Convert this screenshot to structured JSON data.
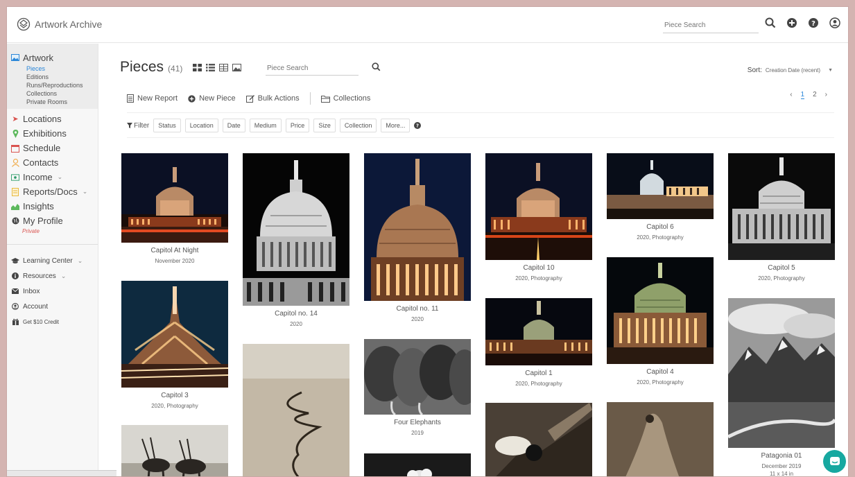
{
  "app": {
    "name": "Artwork Archive"
  },
  "topbar": {
    "search_placeholder": "Piece Search"
  },
  "sidebar": {
    "artwork_label": "Artwork",
    "artwork_subs": [
      {
        "label": "Pieces",
        "active": true
      },
      {
        "label": "Editions"
      },
      {
        "label": "Runs/Reproductions"
      },
      {
        "label": "Collections"
      },
      {
        "label": "Private Rooms"
      }
    ],
    "main_items": [
      {
        "label": "Locations",
        "icon": "location-arrow-icon",
        "color": "#d9534f"
      },
      {
        "label": "Exhibitions",
        "icon": "map-pin-icon",
        "color": "#5cb85c"
      },
      {
        "label": "Schedule",
        "icon": "calendar-icon",
        "color": "#d9534f"
      },
      {
        "label": "Contacts",
        "icon": "user-icon",
        "color": "#f0ad4e"
      },
      {
        "label": "Income",
        "icon": "money-icon",
        "color": "#2e9c6a",
        "has_chevron": true
      },
      {
        "label": "Reports/Docs",
        "icon": "document-icon",
        "color": "#e8b93d",
        "has_chevron": true
      },
      {
        "label": "Insights",
        "icon": "chart-icon",
        "color": "#5cb85c"
      },
      {
        "label": "My Profile",
        "icon": "globe-icon",
        "color": "#444"
      }
    ],
    "profile_status": "Private",
    "bottom_items": [
      {
        "label": "Learning Center",
        "icon": "graduation-cap-icon",
        "has_chevron": true
      },
      {
        "label": "Resources",
        "icon": "info-icon",
        "has_chevron": true
      },
      {
        "label": "Inbox",
        "icon": "envelope-icon"
      },
      {
        "label": "Account",
        "icon": "user-circle-icon"
      },
      {
        "label": "Get $10 Credit",
        "icon": "gift-icon"
      }
    ]
  },
  "main": {
    "title": "Pieces",
    "count": "(41)",
    "search_placeholder": "Piece Search",
    "sort_label": "Sort:",
    "sort_value": "Creation Date (recent)",
    "actions": {
      "new_report": "New Report",
      "new_piece": "New Piece",
      "bulk_actions": "Bulk Actions",
      "collections": "Collections"
    },
    "pager": {
      "prev": "‹",
      "pages": [
        "1",
        "2"
      ],
      "next": "›"
    },
    "filter_label": "Filter",
    "filters": [
      "Status",
      "Location",
      "Date",
      "Medium",
      "Price",
      "Size",
      "Collection",
      "More..."
    ]
  },
  "pieces": [
    {
      "title": "Capitol At Night",
      "meta": "November 2020"
    },
    {
      "title": "Capitol 3",
      "meta": "2020, Photography"
    },
    {
      "title": "Capitol no. 14",
      "meta": "2020"
    },
    {
      "title": "Capitol no. 11",
      "meta": "2020"
    },
    {
      "title": "Four Elephants",
      "meta": "2019"
    },
    {
      "title": "Capitol 10",
      "meta": "2020, Photography"
    },
    {
      "title": "Capitol 1",
      "meta": "2020, Photography"
    },
    {
      "title": "Capitol 6",
      "meta": "2020, Photography"
    },
    {
      "title": "Capitol 4",
      "meta": "2020, Photography"
    },
    {
      "title": "Capitol 5",
      "meta": "2020, Photography"
    },
    {
      "title": "Patagonia 01",
      "meta": "December 2019",
      "size": "11 x 14 in"
    }
  ]
}
